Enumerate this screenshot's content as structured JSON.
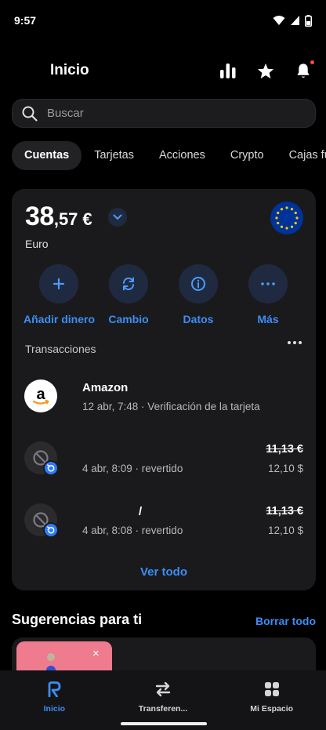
{
  "status_bar": {
    "time": "9:57"
  },
  "header": {
    "title": "Inicio"
  },
  "search": {
    "placeholder": "Buscar"
  },
  "tabs": [
    {
      "label": "Cuentas",
      "active": true
    },
    {
      "label": "Tarjetas"
    },
    {
      "label": "Acciones"
    },
    {
      "label": "Crypto"
    },
    {
      "label": "Cajas fu"
    }
  ],
  "account": {
    "balance_int": "38",
    "balance_dec": ",57",
    "currency_symbol": "€",
    "currency_name": "Euro",
    "flag": "eu-flag-icon"
  },
  "actions": [
    {
      "label": "Añadir dinero",
      "icon": "plus-icon"
    },
    {
      "label": "Cambio",
      "icon": "exchange-icon"
    },
    {
      "label": "Datos",
      "icon": "info-icon"
    },
    {
      "label": "Más",
      "icon": "more-icon"
    }
  ],
  "transactions": {
    "header": "Transacciones",
    "items": [
      {
        "title": "Amazon",
        "subtitle": "12 abr, 7:48 · Verificación de la tarjeta",
        "amount": "",
        "amount2": "",
        "icon": "amazon-logo"
      },
      {
        "title": "",
        "subtitle": "4 abr, 8:09 · revertido",
        "amount": "11,13 €",
        "amount2": "12,10 $",
        "icon": "blocked-icon"
      },
      {
        "title": "/",
        "subtitle": "4 abr, 8:08 · revertido",
        "amount": "11,13 €",
        "amount2": "12,10 $",
        "icon": "blocked-icon"
      }
    ],
    "see_all": "Ver todo"
  },
  "suggestions": {
    "title": "Sugerencias para ti",
    "clear": "Borrar todo",
    "close": "×"
  },
  "bottom_nav": [
    {
      "label": "Inicio",
      "icon": "revolut-r-icon",
      "active": true
    },
    {
      "label": "Transferen...",
      "icon": "transfer-icon"
    },
    {
      "label": "Mi Espacio",
      "icon": "grid-icon"
    }
  ],
  "colors": {
    "accent": "#3b8ef5",
    "background": "#000000",
    "card": "#1a1a1c",
    "notification": "#ff4b3e"
  }
}
